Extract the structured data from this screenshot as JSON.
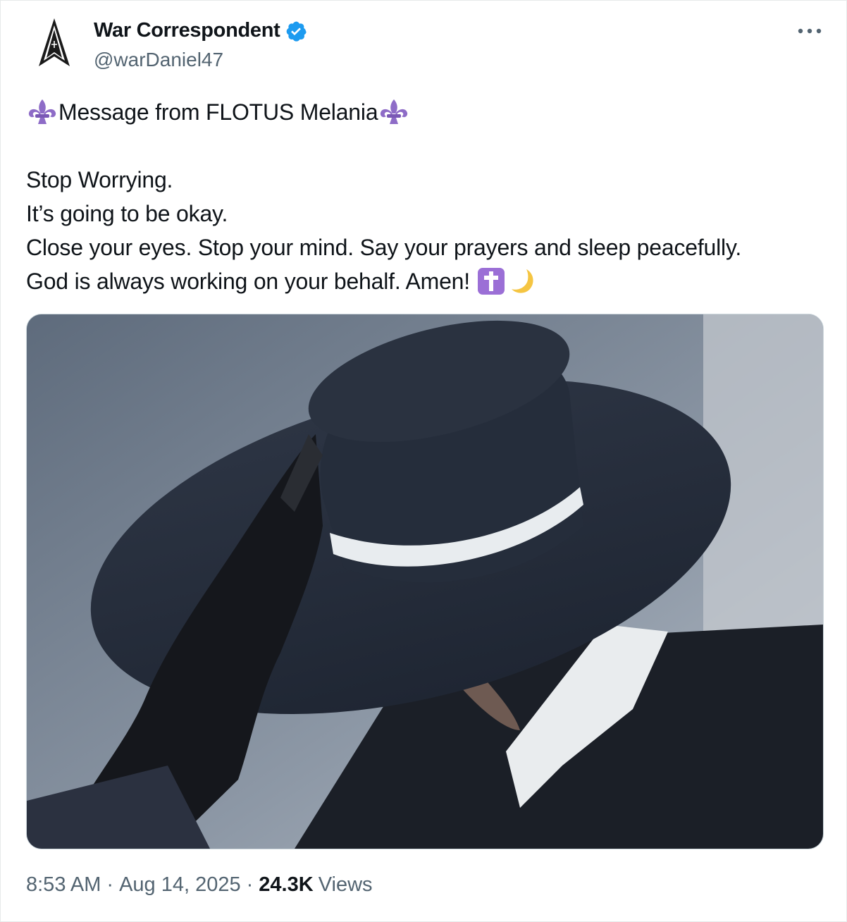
{
  "author": {
    "display_name": "War Correspondent",
    "handle": "@warDaniel47",
    "verified": true,
    "avatar_icon": "spear-insignia-icon"
  },
  "tweet": {
    "headline_emoji": "fleur-de-lis-icon",
    "headline": "Message from FLOTUS Melania",
    "lines": [
      "Stop Worrying.",
      "It’s going to be okay.",
      "Close your eyes. Stop your mind. Say your prayers and sleep peacefully.",
      "God is always working on your behalf. Amen!"
    ],
    "trailing_emojis": [
      "latin-cross-icon",
      "crescent-moon-icon"
    ]
  },
  "meta": {
    "time": "8:53 AM",
    "date": "Aug 14, 2025",
    "views_count": "24.3K",
    "views_label": "Views"
  },
  "colors": {
    "verified_blue": "#1d9bf0",
    "secondary_text": "#536471",
    "emoji_purple": "#8e6cc7"
  }
}
